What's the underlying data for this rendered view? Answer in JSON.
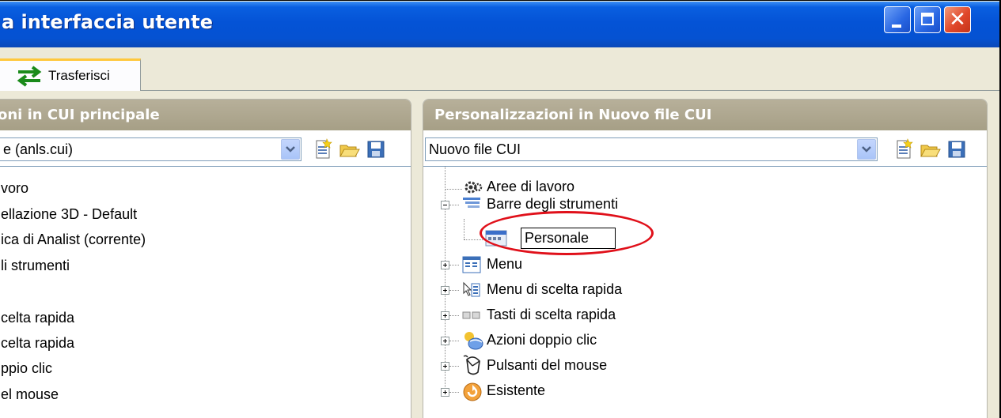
{
  "window": {
    "title": "a interfaccia utente",
    "controls": {
      "minimize": "minimize",
      "maximize": "maximize",
      "close": "close"
    }
  },
  "tabs": [
    {
      "label": "Trasferisci",
      "icon": "transfer-arrows-icon",
      "selected": true
    }
  ],
  "left_panel": {
    "title": "oni in CUI principale",
    "combo_value": "e (anls.cui)",
    "items": [
      "voro",
      "ellazione 3D - Default",
      "ica di Analist (corrente)",
      "li strumenti",
      "",
      "celta rapida",
      "celta rapida",
      "ppio clic",
      "el mouse"
    ]
  },
  "right_panel": {
    "title": "Personalizzazioni in Nuovo file CUI",
    "combo_value": "Nuovo file CUI",
    "tree": [
      {
        "label": "Aree di lavoro",
        "icon": "workspace-gear-icon",
        "expander": "none"
      },
      {
        "label": "Barre degli strumenti",
        "icon": "toolbar-icon",
        "expander": "minus"
      },
      {
        "label": "Personale",
        "icon": "toolbar-item-icon",
        "expander": "none",
        "editing": true
      },
      {
        "label": "Menu",
        "icon": "menu-icon",
        "expander": "plus"
      },
      {
        "label": "Menu di scelta rapida",
        "icon": "shortcut-menu-icon",
        "expander": "plus"
      },
      {
        "label": "Tasti di scelta rapida",
        "icon": "shortcut-keys-icon",
        "expander": "plus"
      },
      {
        "label": "Azioni doppio clic",
        "icon": "double-click-icon",
        "expander": "plus"
      },
      {
        "label": "Pulsanti del mouse",
        "icon": "mouse-icon",
        "expander": "plus"
      },
      {
        "label": "Esistente",
        "icon": "legacy-icon",
        "expander": "plus"
      }
    ]
  },
  "toolbar_icons": [
    "new-file-icon",
    "open-folder-icon",
    "save-icon"
  ],
  "colors": {
    "titlebar": "#0453d6",
    "panel_header": "#a69f86",
    "tab_highlight": "#ffc83c",
    "annotation": "#e0101a"
  }
}
